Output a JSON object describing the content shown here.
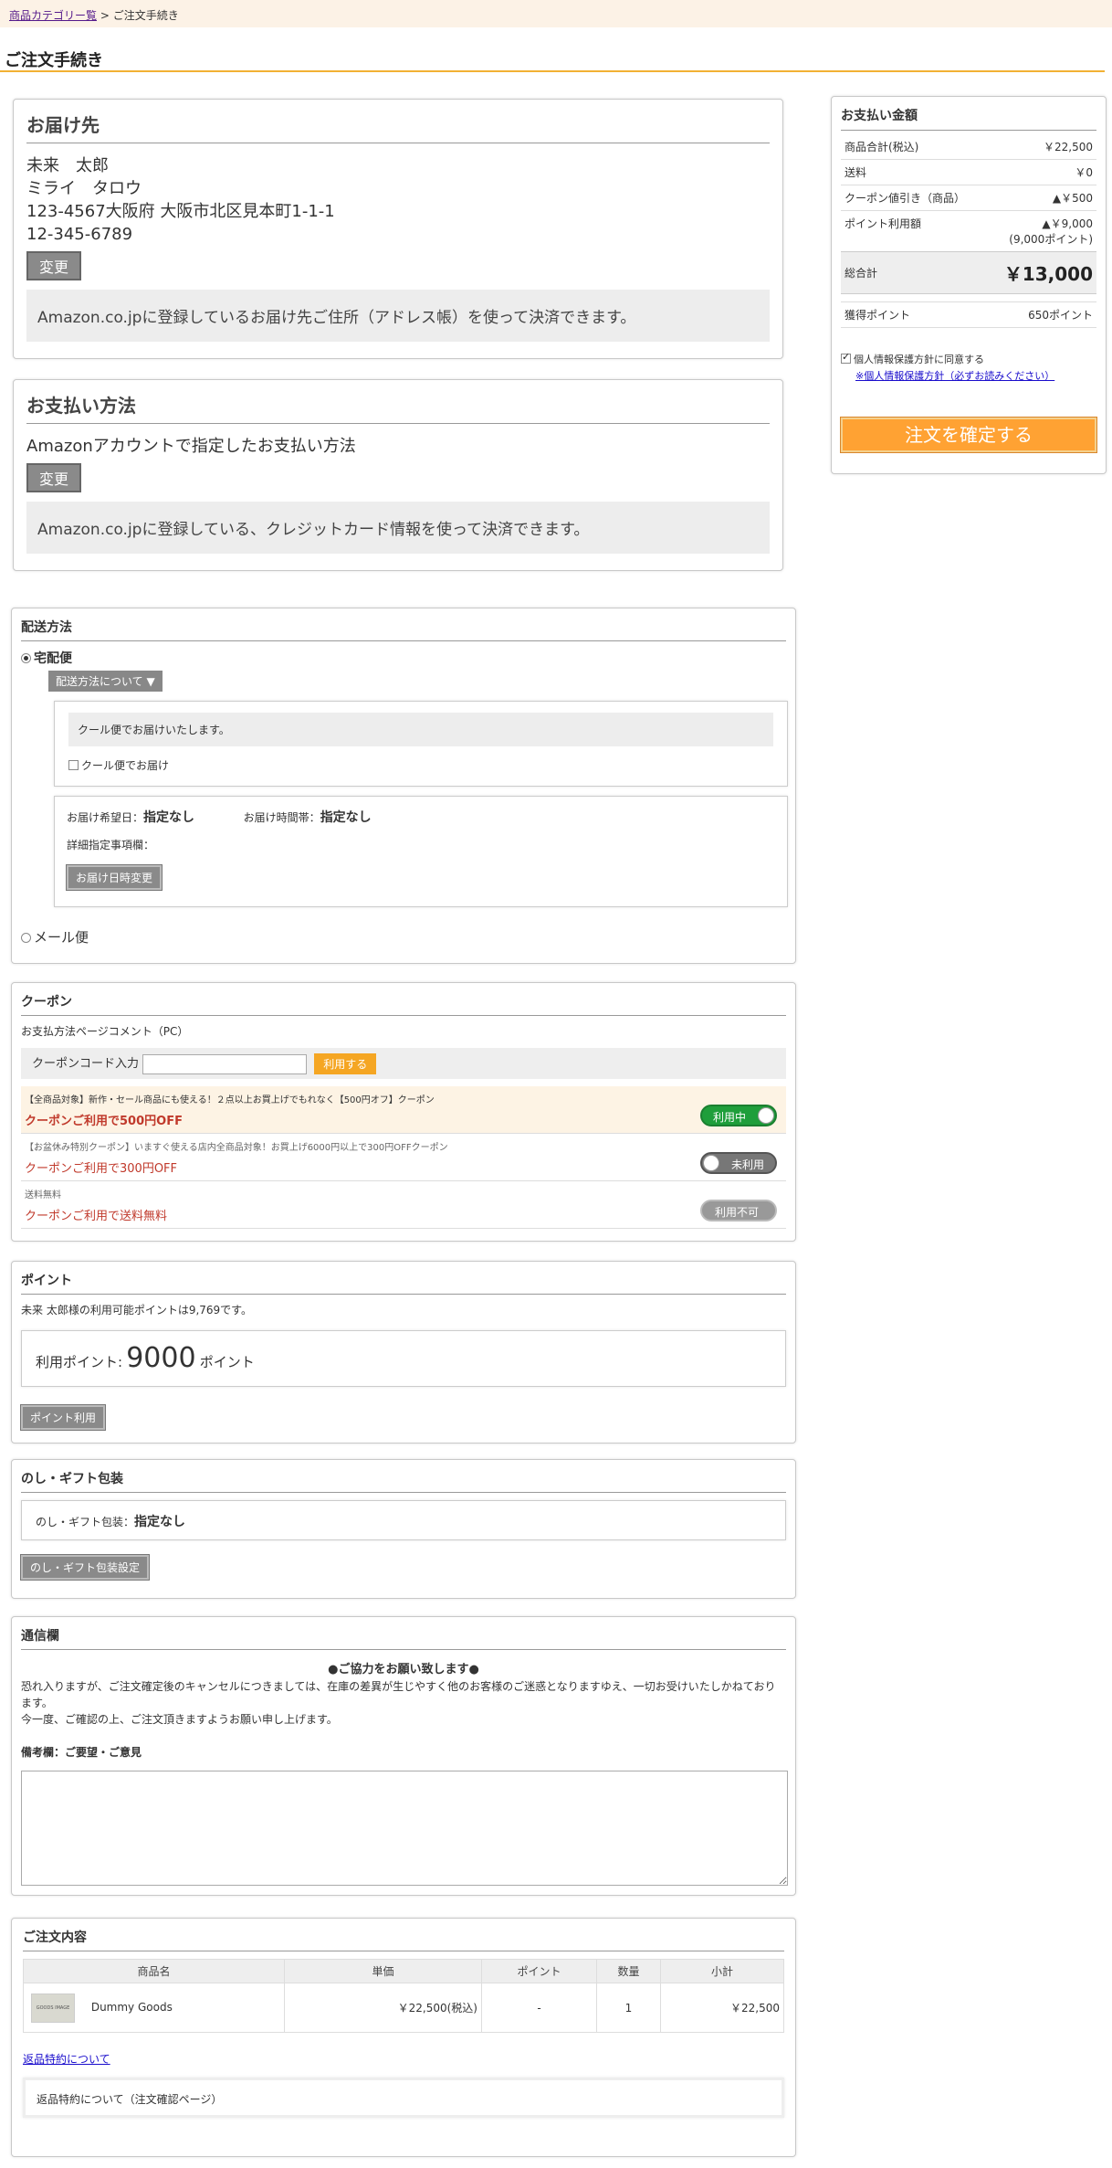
{
  "breadcrumb": {
    "link": "商品カテゴリー覧",
    "separator": ">",
    "current": "ご注文手続き"
  },
  "page_title": "ご注文手続き",
  "delivery_address": {
    "heading": "お届け先",
    "name": "未来　太郎",
    "kana": "ミライ　タロウ",
    "address": "123-4567大阪府 大阪市北区見本町1-1-1",
    "phone": "12-345-6789",
    "change_label": "変更",
    "note": "Amazon.co.jpに登録しているお届け先ご住所（アドレス帳）を使って決済できます。"
  },
  "payment_method": {
    "heading": "お支払い方法",
    "text": "Amazonアカウントで指定したお支払い方法",
    "change_label": "変更",
    "note": "Amazon.co.jpに登録している、クレジットカード情報を使って決済できます。"
  },
  "shipping": {
    "heading": "配送方法",
    "option1": "宅配便",
    "about_label": "配送方法について ▼",
    "cool_note": "クール便でお届けいたします。",
    "cool_checkbox": "クール便でお届け",
    "date_label": "お届け希望日：",
    "date_value": "指定なし",
    "time_label": "お届け時間帯：",
    "time_value": "指定なし",
    "detail_label": "詳細指定事項欄：",
    "change_datetime": "お届け日時変更",
    "option2": "メール便"
  },
  "coupon": {
    "heading": "クーポン",
    "comment": "お支払方法ページコメント（PC）",
    "code_label": "クーポンコード入力",
    "code_value": "",
    "apply_label": "利用する",
    "items": [
      {
        "desc": "【全商品対象】新作・セール商品にも使える！２点以上お買上げでもれなく【500円オフ】クーポン",
        "title": "クーポンご利用で500円OFF",
        "status": "利用中"
      },
      {
        "desc": "【お盆休み特別クーポン】いますぐ使える店内全商品対象！お買上げ6000円以上で300円OFFクーポン",
        "title": "クーポンご利用で300円OFF",
        "status": "未利用"
      },
      {
        "desc": "送料無料",
        "title": "クーポンご利用で送料無料",
        "status": "利用不可"
      }
    ]
  },
  "points": {
    "heading": "ポイント",
    "available": "未来 太郎様の利用可能ポイントは9,769です。",
    "use_label": "利用ポイント:",
    "use_value": "9000",
    "unit": "ポイント",
    "button": "ポイント利用"
  },
  "gift": {
    "heading": "のし・ギフト包装",
    "label": "のし・ギフト包装：",
    "value": "指定なし",
    "button": "のし・ギフト包装設定"
  },
  "message": {
    "heading": "通信欄",
    "request": "●ご協力をお願い致します●",
    "body1": "恐れ入りますが、ご注文確定後のキャンセルにつきましては、在庫の差異が生じやすく他のお客様のご迷惑となりますゆえ、一切お受けいたしかねております。",
    "body2": "今一度、ご確認の上、ご注文頂きますようお願い申し上げます。",
    "remarks_label": "備考欄：ご要望・ご意見",
    "remarks_value": ""
  },
  "order": {
    "heading": "ご注文内容",
    "columns": [
      "商品名",
      "単価",
      "ポイント",
      "数量",
      "小計"
    ],
    "items": [
      {
        "thumb_text": "GOODS IMAGE",
        "name": "Dummy Goods",
        "price": "￥22,500(税込)",
        "point": "-",
        "qty": "1",
        "subtotal": "￥22,500"
      }
    ],
    "return_link": "返品特約について",
    "return_text": "返品特約について（注文確認ページ）"
  },
  "summary": {
    "heading": "お支払い金額",
    "rows": [
      {
        "label": "商品合計(税込)",
        "value": "￥22,500"
      },
      {
        "label": "送料",
        "value": "￥0"
      },
      {
        "label": "クーポン値引き（商品）",
        "value": "▲￥500"
      },
      {
        "label": "ポイント利用額",
        "value": "▲￥9,000",
        "sub": "(9,000ポイント)"
      }
    ],
    "total_label": "総合計",
    "total_value": "￥13,000",
    "earn_label": "獲得ポイント",
    "earn_value": "650ポイント",
    "privacy_agree": "個人情報保護方針に同意する",
    "privacy_link": "※個人情報保護方針（必ずお読みください）",
    "confirm_label": "注文を確定する"
  },
  "colors": {
    "accent": "#f2b134",
    "confirm": "#ffa233",
    "red": "#c0392b",
    "on_green": "#1f9e3b"
  }
}
